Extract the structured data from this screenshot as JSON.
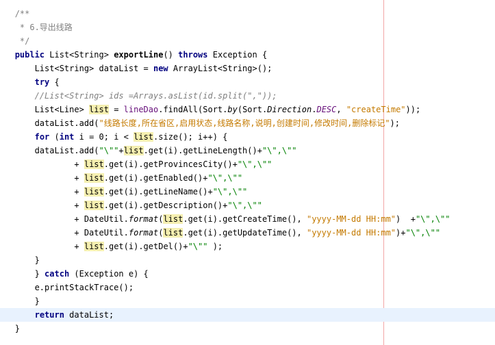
{
  "code_lines": [
    "/**",
    " * 6.导出线路",
    " */",
    "public List<String> exportLine() throws Exception {",
    "    List<String> dataList = new ArrayList<String>();",
    "    try {",
    "    //List<String> ids =Arrays.asList(id.split(\",\"));",
    "    List<Line> list = lineDao.findAll(Sort.by(Sort.Direction.DESC, \"createTime\"));",
    "    dataList.add(\"线路长度,所在省区,启用状态,线路名称,说明,创建时间,修改时间,删除标记\");",
    "    for (int i = 0; i < list.size(); i++) {",
    "    dataList.add(\"\\\"\"+list.get(i).getLineLength()+\"\\\",\\\"\"",
    "            + list.get(i).getProvincesCity()+\"\\\",\\\"\"",
    "            + list.get(i).getEnabled()+\"\\\",\\\"\"",
    "            + list.get(i).getLineName()+\"\\\",\\\"\"",
    "            + list.get(i).getDescription()+\"\\\",\\\"\"",
    "            + DateUtil.format(list.get(i).getCreateTime(), \"yyyy-MM-dd HH:mm\")  +\"\\\",\\\"\"",
    "            + DateUtil.format(list.get(i).getUpdateTime(), \"yyyy-MM-dd HH:mm\")+\"\\\",\\\"\"",
    "            + list.get(i).getDel()+\"\\\"\" );",
    "    }",
    "    } catch (Exception e) {",
    "    e.printStackTrace();",
    "    }",
    "    return dataList;",
    "}"
  ],
  "editor": {
    "current_line_index": 22,
    "colors": {
      "background": "#ffffff",
      "keyword": "#000080",
      "comment": "#808080",
      "string": "#008000",
      "usage_highlight": "#f5efb0",
      "current_line": "#e8f2fe",
      "right_margin": "#f2a6a6"
    }
  }
}
